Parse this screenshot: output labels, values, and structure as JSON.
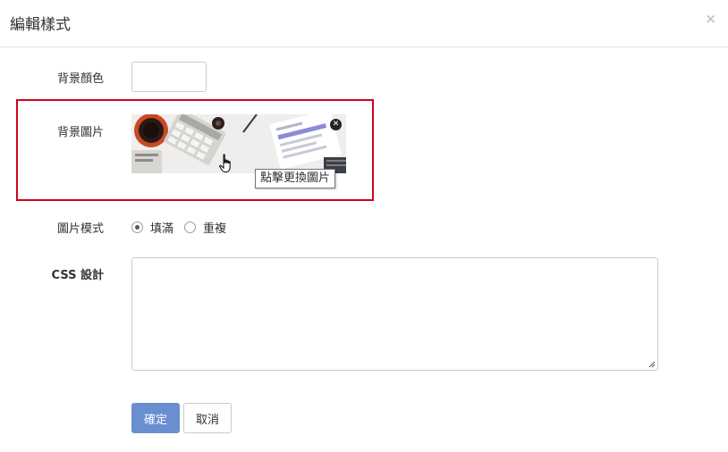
{
  "modal": {
    "title": "編輯樣式",
    "close_label": "×"
  },
  "form": {
    "bg_color_label": "背景顏色",
    "bg_color_value": "",
    "bg_image_label": "背景圖片",
    "bg_image_tooltip": "點擊更換圖片",
    "image_mode_label": "圖片模式",
    "image_mode_options": [
      {
        "label": "填滿",
        "checked": true
      },
      {
        "label": "重複",
        "checked": false
      }
    ],
    "css_label": "CSS 設計",
    "css_value": ""
  },
  "buttons": {
    "confirm": "確定",
    "cancel": "取消"
  },
  "colors": {
    "highlight": "#d0021b",
    "primary": "#6a8fd1"
  }
}
